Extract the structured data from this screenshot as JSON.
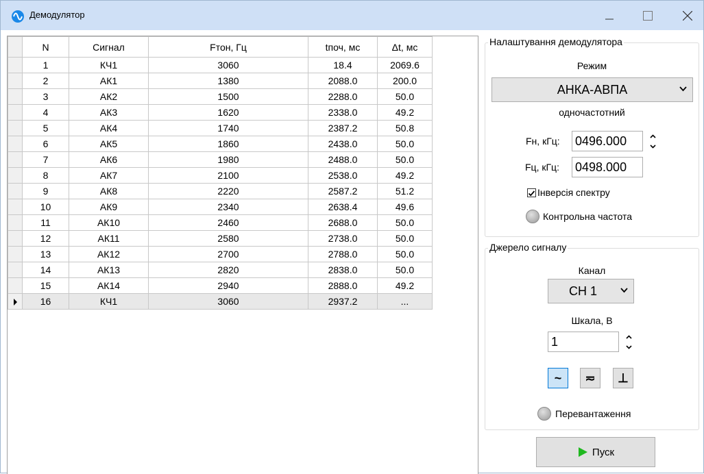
{
  "window": {
    "title": "Демодулятор"
  },
  "table": {
    "columns": [
      "N",
      "Сигнал",
      "Fтон, Гц",
      "tпоч, мс",
      "Δt, мс"
    ],
    "rows": [
      [
        "1",
        "КЧ1",
        "3060",
        "18.4",
        "2069.6"
      ],
      [
        "2",
        "АК1",
        "1380",
        "2088.0",
        "200.0"
      ],
      [
        "3",
        "АК2",
        "1500",
        "2288.0",
        "50.0"
      ],
      [
        "4",
        "АК3",
        "1620",
        "2338.0",
        "49.2"
      ],
      [
        "5",
        "АК4",
        "1740",
        "2387.2",
        "50.8"
      ],
      [
        "6",
        "АК5",
        "1860",
        "2438.0",
        "50.0"
      ],
      [
        "7",
        "АК6",
        "1980",
        "2488.0",
        "50.0"
      ],
      [
        "8",
        "АК7",
        "2100",
        "2538.0",
        "49.2"
      ],
      [
        "9",
        "АК8",
        "2220",
        "2587.2",
        "51.2"
      ],
      [
        "10",
        "АК9",
        "2340",
        "2638.4",
        "49.6"
      ],
      [
        "11",
        "АК10",
        "2460",
        "2688.0",
        "50.0"
      ],
      [
        "12",
        "АК11",
        "2580",
        "2738.0",
        "50.0"
      ],
      [
        "13",
        "АК12",
        "2700",
        "2788.0",
        "50.0"
      ],
      [
        "14",
        "АК13",
        "2820",
        "2838.0",
        "50.0"
      ],
      [
        "15",
        "АК14",
        "2940",
        "2888.0",
        "49.2"
      ],
      [
        "16",
        "КЧ1",
        "3060",
        "2937.2",
        "..."
      ]
    ],
    "selected_row": 16
  },
  "demod": {
    "legend": "Налаштування демодулятора",
    "mode_label": "Режим",
    "mode_value": "АНКА-АВПА",
    "mode_desc": "одночастотний",
    "fn_label": "Fн, кГц:",
    "fn_value": "0496.000",
    "fc_label": "Fц, кГц:",
    "fc_value": "0498.000",
    "inversion_label": "Інверсія спектру",
    "inversion_checked": true,
    "control_freq_label": "Контрольна частота"
  },
  "source": {
    "legend": "Джерело сигналу",
    "channel_label": "Канал",
    "channel_value": "CH 1",
    "scale_label": "Шкала, В",
    "scale_value": "1",
    "coupling": {
      "ac": "~",
      "dc": "≂",
      "gnd": "⊥",
      "active": "ac"
    },
    "overload_label": "Перевантаження"
  },
  "start_label": "Пуск",
  "colors": {
    "titlebar": "#cfe0f6",
    "play_icon": "#1fb81f",
    "active_button": "#cce4f7"
  }
}
